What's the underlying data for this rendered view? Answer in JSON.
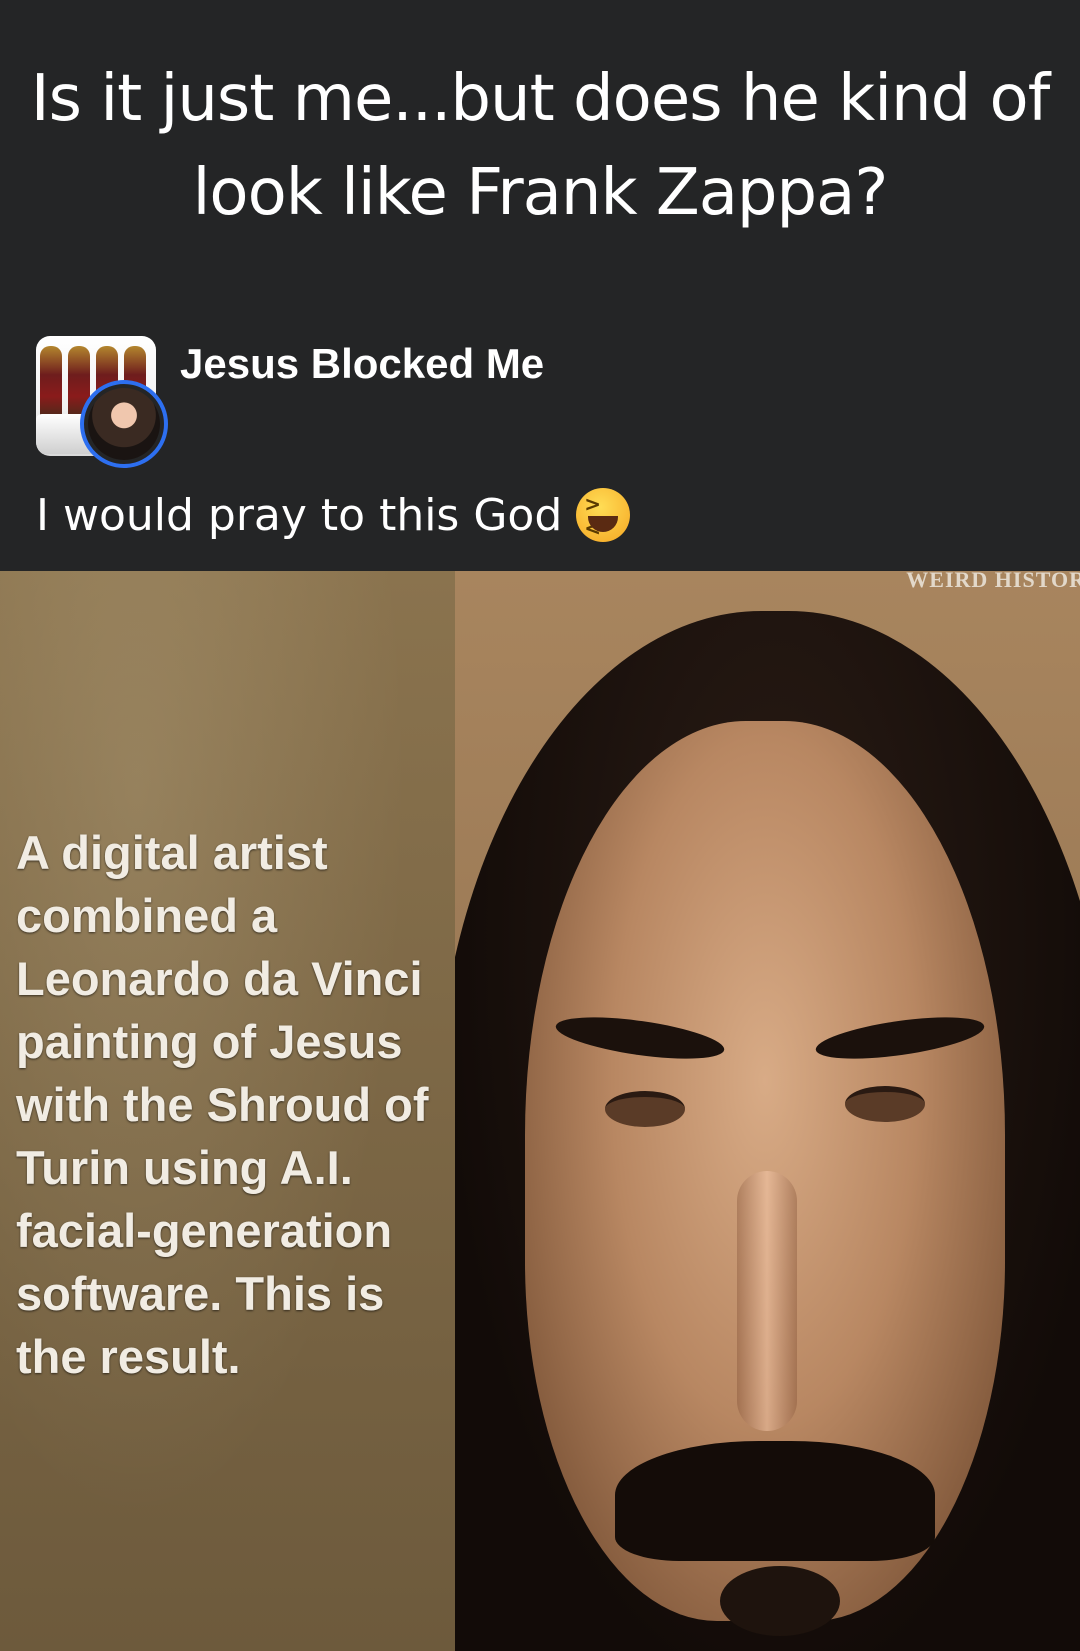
{
  "post": {
    "caption": "Is it just me...but does he kind of look like Frank Zappa?",
    "author": "Jesus Blocked Me",
    "text": "I would pray to this God",
    "emoji": "laughing-face-emoji"
  },
  "meme": {
    "text": "A digital artist combined a Leonardo da Vinci painting of Jesus with the Shroud of Turin using A.I. facial-generation software. This is the result.",
    "watermark": "WEIRD HISTOR"
  },
  "colors": {
    "background": "#242526",
    "avatar_ring": "#2d6ff0",
    "text": "#ffffff"
  }
}
